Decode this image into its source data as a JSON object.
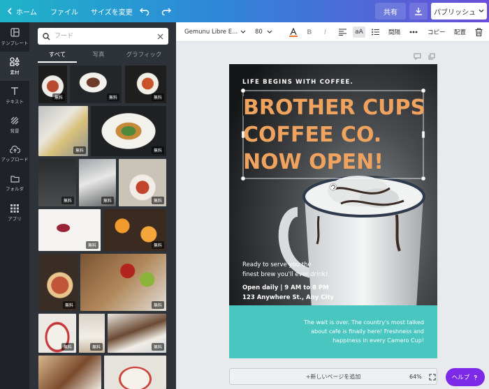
{
  "topbar": {
    "home_label": "ホーム",
    "file_label": "ファイル",
    "resize_label": "サイズを変更",
    "share_label": "共有",
    "publish_label": "パブリッシュ"
  },
  "rail": {
    "items": [
      {
        "label": "テンプレート"
      },
      {
        "label": "素材"
      },
      {
        "label": "テキスト"
      },
      {
        "label": "背景"
      },
      {
        "label": "アップロード"
      },
      {
        "label": "フォルダ"
      },
      {
        "label": "アプリ"
      }
    ]
  },
  "panel": {
    "search_placeholder": "フード",
    "tabs": [
      {
        "label": "すべて"
      },
      {
        "label": "写真"
      },
      {
        "label": "グラフィック"
      }
    ],
    "free_badge": "無料"
  },
  "toolbar": {
    "font_family": "Gemunu Libre E...",
    "font_size": "80",
    "case_label": "aA",
    "spacing_label": "間隔",
    "copy_label": "コピー",
    "arrange_label": "配置",
    "text_color": "#e1762d"
  },
  "canvas": {
    "headline_small": "LIFE BEGINS WITH COFFEE.",
    "headline_lines": [
      "BROTHER CUPS",
      "COFFEE CO.",
      "NOW OPEN!"
    ],
    "serve_line_1": "Ready to serve you the",
    "serve_line_2": "finest brew you'll ever drink!",
    "hours": "Open daily | 9 AM to 8 PM",
    "address": "123 Anywhere St., Any City",
    "footer_line_1": "The wait is over. The country's most talked",
    "footer_line_2": "about cafe is finally here! Freshness and",
    "footer_line_3": "happiness in every Camero Cup!",
    "accent_color": "#f0a35e",
    "footer_color": "#4ac6c0",
    "add_page_label": "+新しいページを追加",
    "zoom": "64%",
    "help_label": "ヘルプ"
  }
}
